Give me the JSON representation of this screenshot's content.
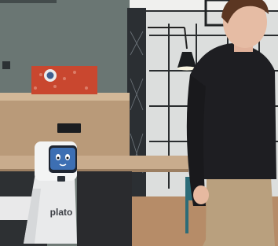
{
  "robot": {
    "brand_label": "plato"
  },
  "palette": {
    "wall": "#6f7a76",
    "counter_wood": "#c7a98a",
    "robot_white": "#f1f2f2",
    "screen_blue": "#3d6fb3",
    "sweater": "#1e1e22",
    "trousers": "#b9a07e",
    "gift_box": "#c9472f"
  }
}
